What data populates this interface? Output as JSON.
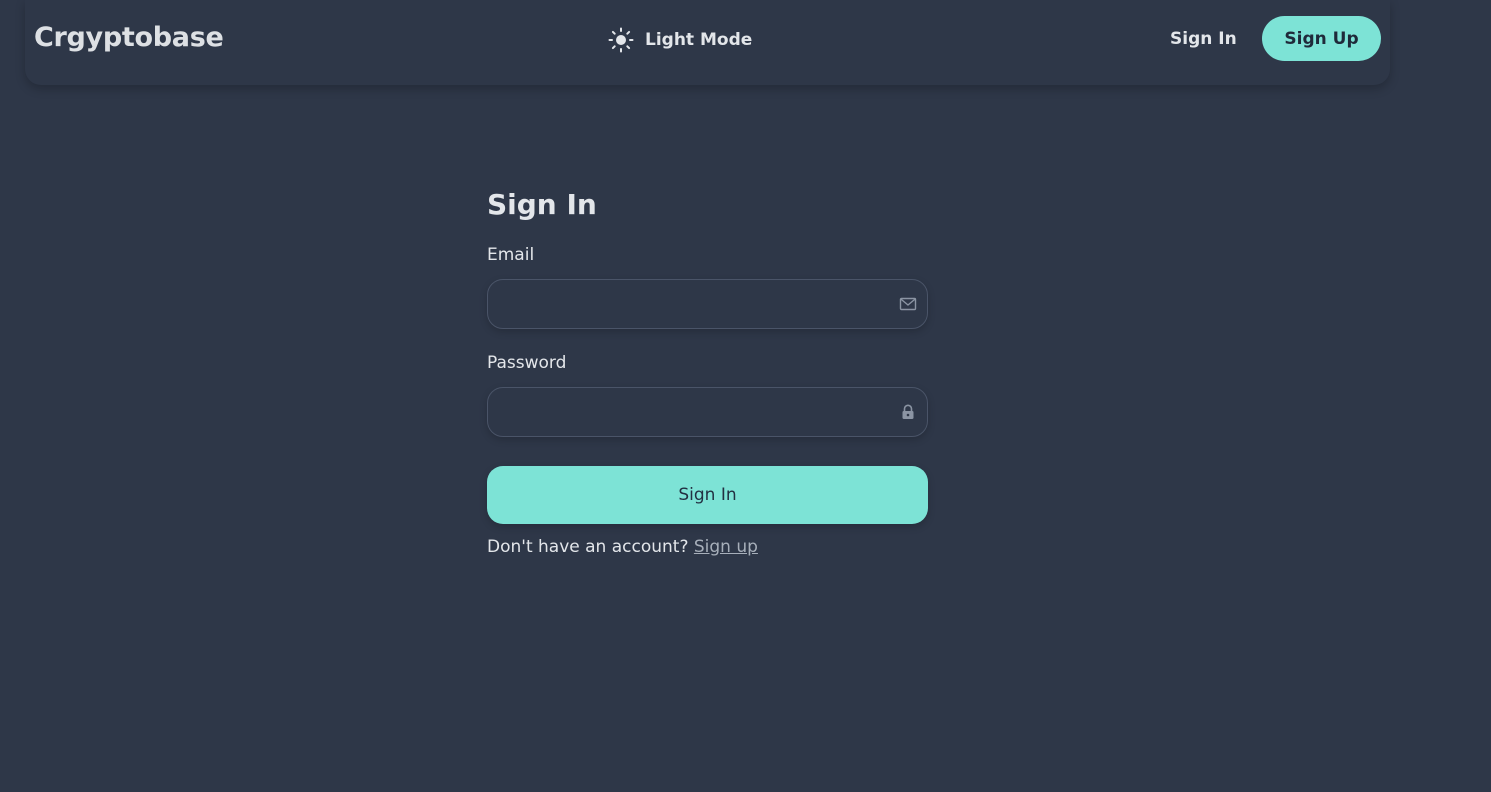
{
  "nav": {
    "brand": "Crgyptobase",
    "theme_toggle_label": "Light Mode",
    "sign_in_label": "Sign In",
    "sign_up_label": "Sign Up"
  },
  "form": {
    "title": "Sign In",
    "email_label": "Email",
    "email_value": "",
    "password_label": "Password",
    "password_value": "",
    "submit_label": "Sign In",
    "footer_text": "Don't have an account?",
    "footer_link": "Sign up"
  },
  "icons": {
    "theme": "sun-icon",
    "email": "envelope-icon",
    "password": "lock-icon"
  },
  "colors": {
    "background": "#2e3748",
    "accent": "#7de3d6"
  }
}
